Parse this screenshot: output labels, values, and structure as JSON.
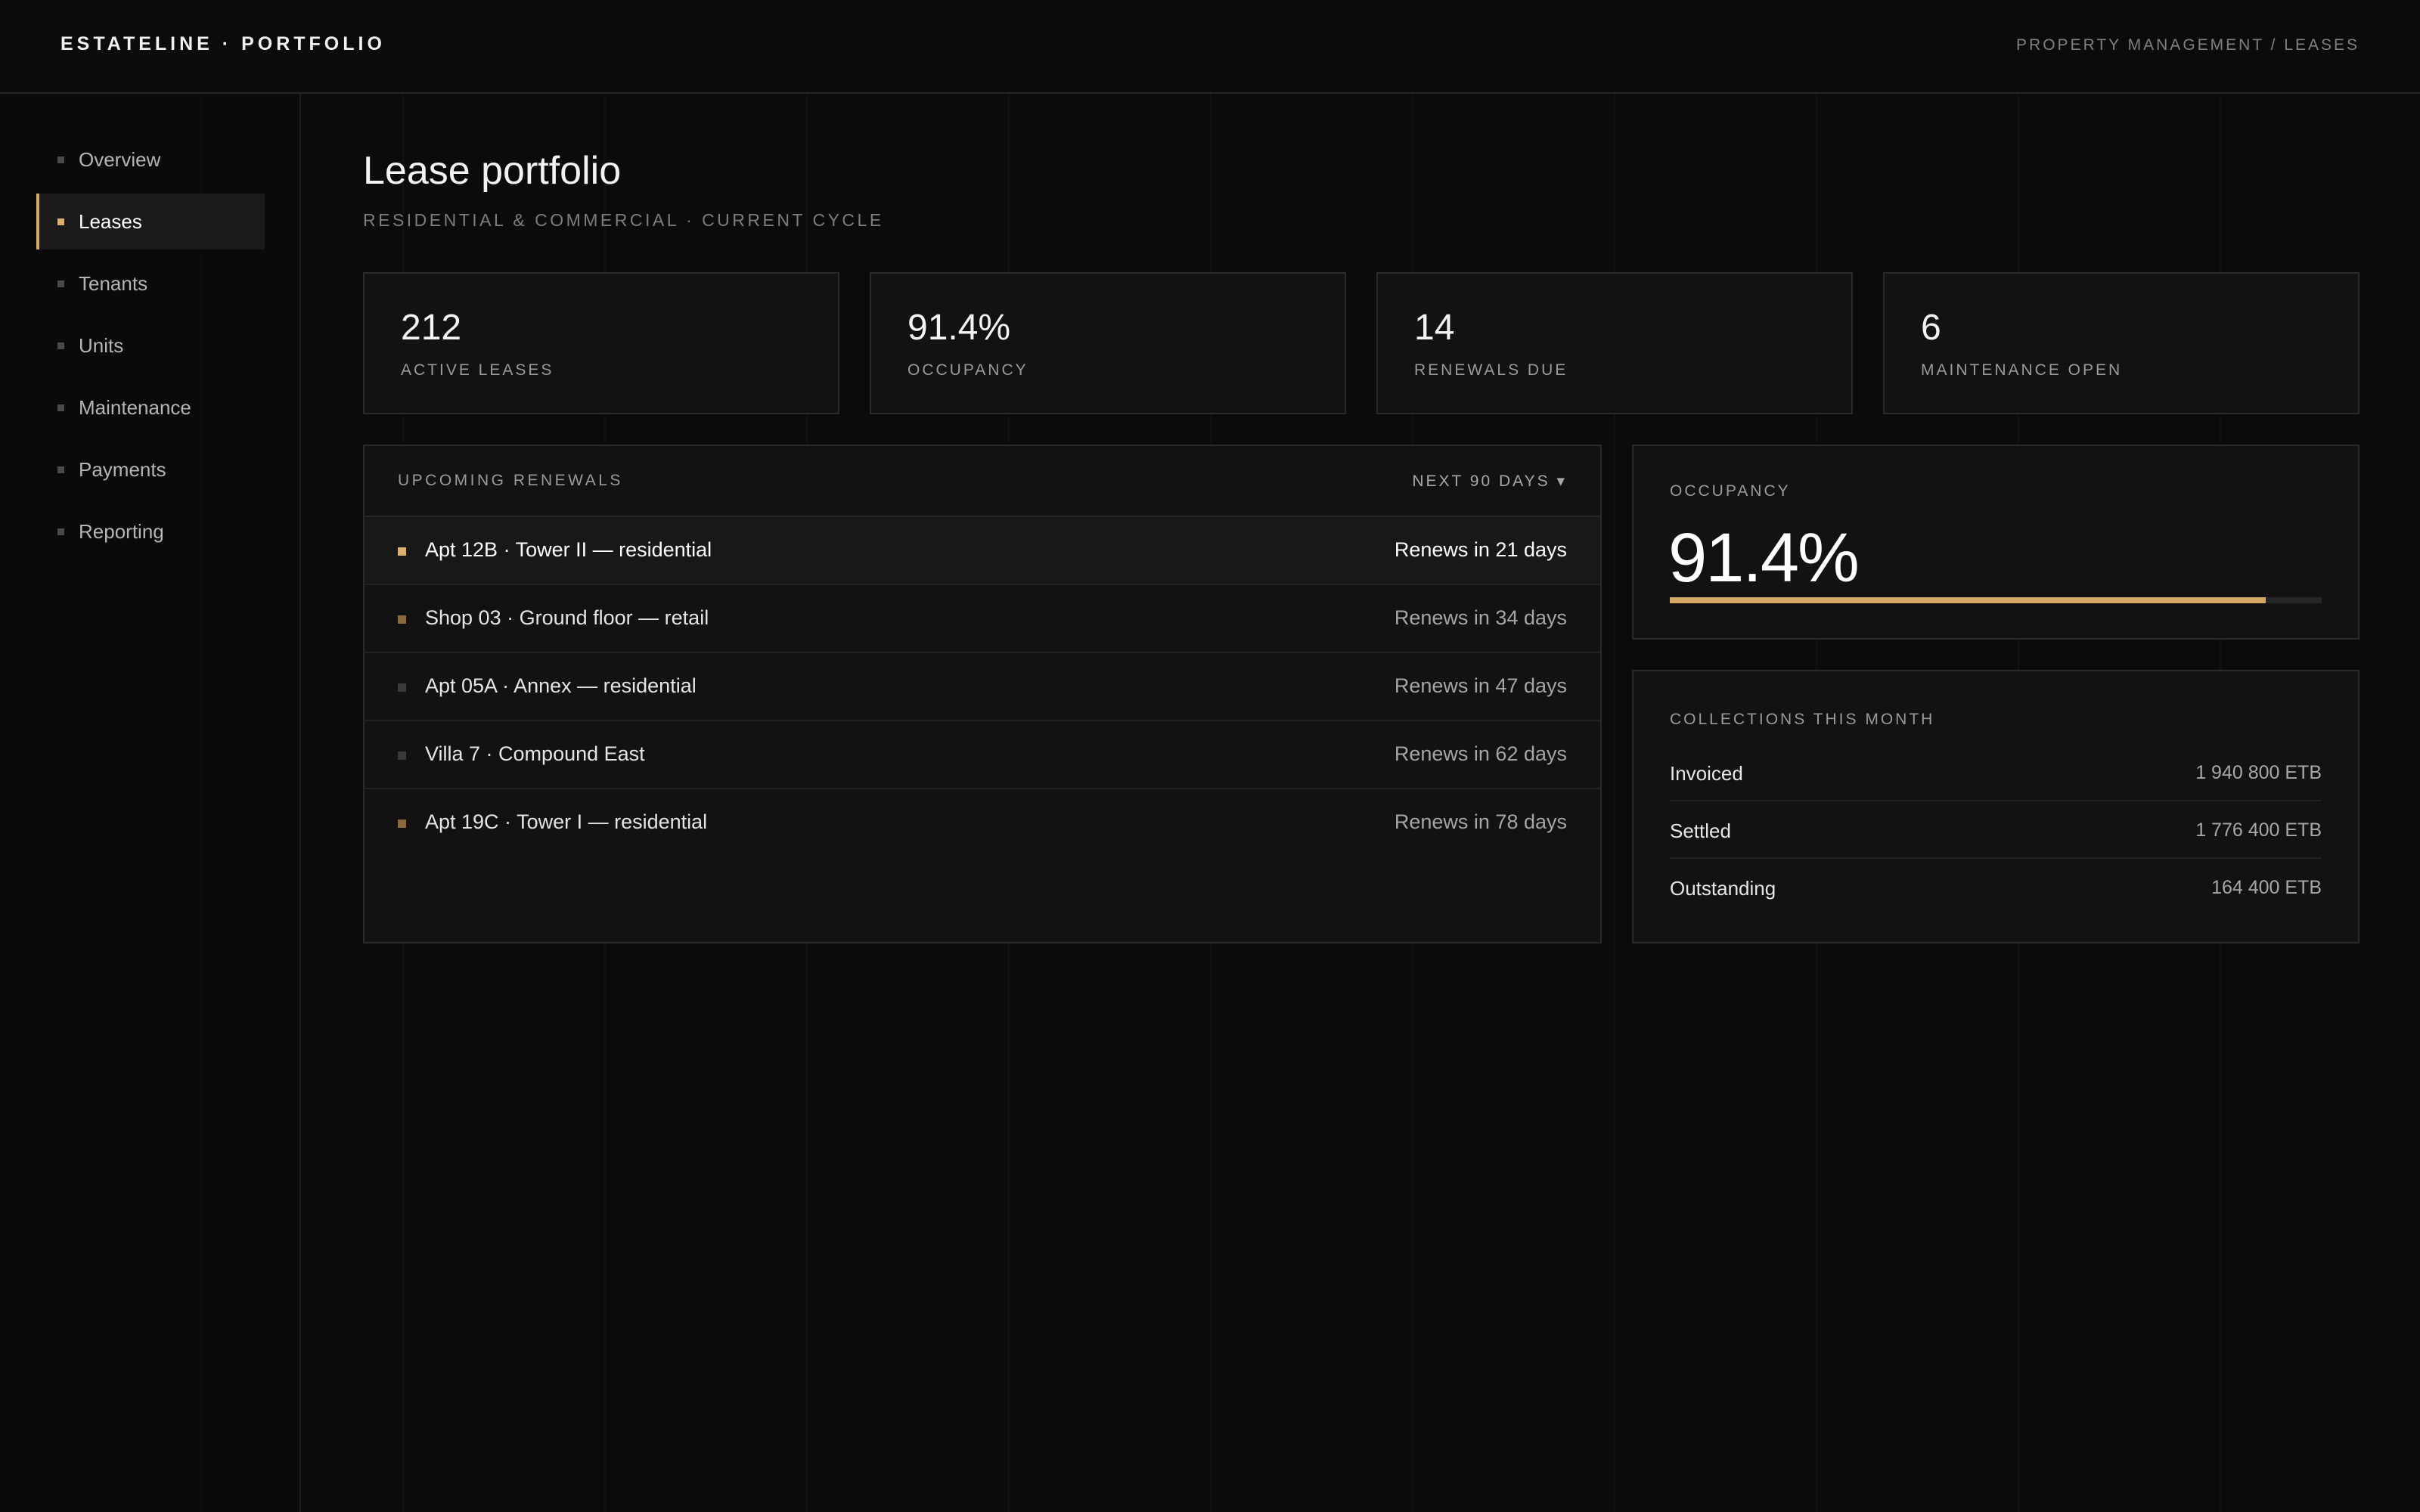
{
  "header": {
    "brand": "ESTATELINE · PORTFOLIO",
    "breadcrumb": "PROPERTY MANAGEMENT / LEASES"
  },
  "sidebar": {
    "items": [
      {
        "label": "Overview",
        "active": false
      },
      {
        "label": "Leases",
        "active": true
      },
      {
        "label": "Tenants",
        "active": false
      },
      {
        "label": "Units",
        "active": false
      },
      {
        "label": "Maintenance",
        "active": false
      },
      {
        "label": "Payments",
        "active": false
      },
      {
        "label": "Reporting",
        "active": false
      }
    ]
  },
  "page": {
    "title": "Lease portfolio",
    "subtitle": "RESIDENTIAL & COMMERCIAL · CURRENT CYCLE"
  },
  "stats": [
    {
      "value": "212",
      "label": "ACTIVE LEASES"
    },
    {
      "value": "91.4%",
      "label": "OCCUPANCY"
    },
    {
      "value": "14",
      "label": "RENEWALS DUE"
    },
    {
      "value": "6",
      "label": "MAINTENANCE OPEN"
    }
  ],
  "renewals": {
    "title": "UPCOMING RENEWALS",
    "filter": "NEXT 90 DAYS ▾",
    "rows": [
      {
        "name": "Apt 12B · Tower II — residential",
        "due": "Renews in 21 days",
        "marker": "#d9b072"
      },
      {
        "name": "Shop 03 · Ground floor — retail",
        "due": "Renews in 34 days",
        "marker": "#8a6a3c"
      },
      {
        "name": "Apt 05A · Annex — residential",
        "due": "Renews in 47 days",
        "marker": "#3a3a3a"
      },
      {
        "name": "Villa 7 · Compound East",
        "due": "Renews in 62 days",
        "marker": "#3a3a3a"
      },
      {
        "name": "Apt 19C · Tower I — residential",
        "due": "Renews in 78 days",
        "marker": "#8a6a3c"
      }
    ]
  },
  "occupancy": {
    "label": "OCCUPANCY",
    "value": "91.4%",
    "fraction": 0.914
  },
  "collections": {
    "label": "COLLECTIONS THIS MONTH",
    "rows": [
      {
        "key": "Invoiced",
        "value": "1 940 800 ETB"
      },
      {
        "key": "Settled",
        "value": "1 776 400 ETB"
      },
      {
        "key": "Outstanding",
        "value": "164 400 ETB"
      }
    ]
  },
  "colors": {
    "accent": "#d4a964",
    "background": "#0b0b0b",
    "panel": "#121212"
  }
}
